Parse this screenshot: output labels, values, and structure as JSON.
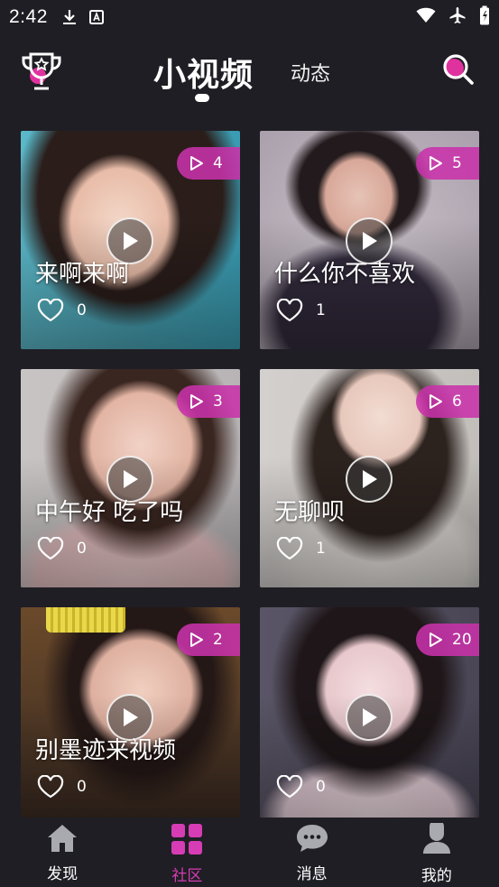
{
  "status_bar": {
    "time": "2:42"
  },
  "header": {
    "title": "小视频",
    "secondary_tab": "动态"
  },
  "colors": {
    "accent": "#d63cb4",
    "background": "#1f1e24",
    "badge": "#c832aa"
  },
  "videos": [
    {
      "caption": "来啊来啊",
      "plays": "4",
      "likes": "0"
    },
    {
      "caption": "什么你不喜欢",
      "plays": "5",
      "likes": "1"
    },
    {
      "caption": "中午好 吃了吗",
      "plays": "3",
      "likes": "0"
    },
    {
      "caption": "无聊呗",
      "plays": "6",
      "likes": "1"
    },
    {
      "caption": "别墨迹来视频",
      "plays": "2",
      "likes": "0"
    },
    {
      "caption": "",
      "plays": "20",
      "likes": "0"
    }
  ],
  "bottom_nav": [
    {
      "label": "发现",
      "icon": "home-icon",
      "active": false
    },
    {
      "label": "社区",
      "icon": "grid-icon",
      "active": true
    },
    {
      "label": "消息",
      "icon": "chat-icon",
      "active": false
    },
    {
      "label": "我的",
      "icon": "person-icon",
      "active": false
    }
  ]
}
